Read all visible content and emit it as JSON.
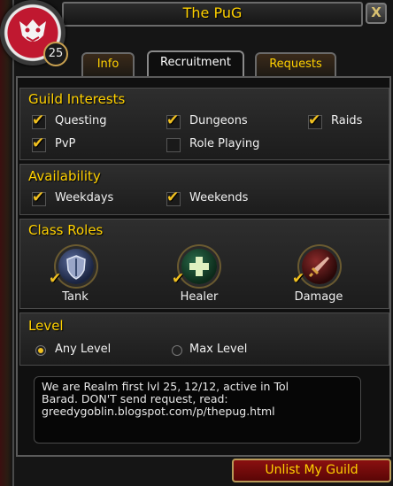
{
  "window": {
    "title": "The PuG",
    "close_glyph": "X"
  },
  "guild": {
    "level": "25",
    "emblem_icon": "guild-emblem-icon"
  },
  "tabs": [
    {
      "label": "Info",
      "active": false
    },
    {
      "label": "Recruitment",
      "active": true
    },
    {
      "label": "Requests",
      "active": false
    }
  ],
  "interests": {
    "title": "Guild Interests",
    "items": [
      {
        "label": "Questing",
        "checked": true
      },
      {
        "label": "Dungeons",
        "checked": true
      },
      {
        "label": "Raids",
        "checked": true
      },
      {
        "label": "PvP",
        "checked": true
      },
      {
        "label": "Role Playing",
        "checked": false
      }
    ]
  },
  "availability": {
    "title": "Availability",
    "items": [
      {
        "label": "Weekdays",
        "checked": true
      },
      {
        "label": "Weekends",
        "checked": true
      }
    ]
  },
  "roles": {
    "title": "Class Roles",
    "items": [
      {
        "label": "Tank",
        "checked": true,
        "icon": "shield-icon"
      },
      {
        "label": "Healer",
        "checked": true,
        "icon": "cross-icon"
      },
      {
        "label": "Damage",
        "checked": true,
        "icon": "sword-icon"
      }
    ]
  },
  "level": {
    "title": "Level",
    "options": [
      {
        "label": "Any Level",
        "selected": true
      },
      {
        "label": "Max Level",
        "selected": false
      }
    ]
  },
  "comment": {
    "lines": [
      "We are Realm first lvl 25, 12/12, active in Tol",
      "Barad. DON'T send request, read:",
      "greedygoblin.blogspot.com/p/thepug.html"
    ]
  },
  "actions": {
    "unlist_label": "Unlist My Guild"
  },
  "colors": {
    "accent_gold": "#ffd100",
    "check_gold": "#f0c020",
    "button_red": "#8a1010"
  }
}
